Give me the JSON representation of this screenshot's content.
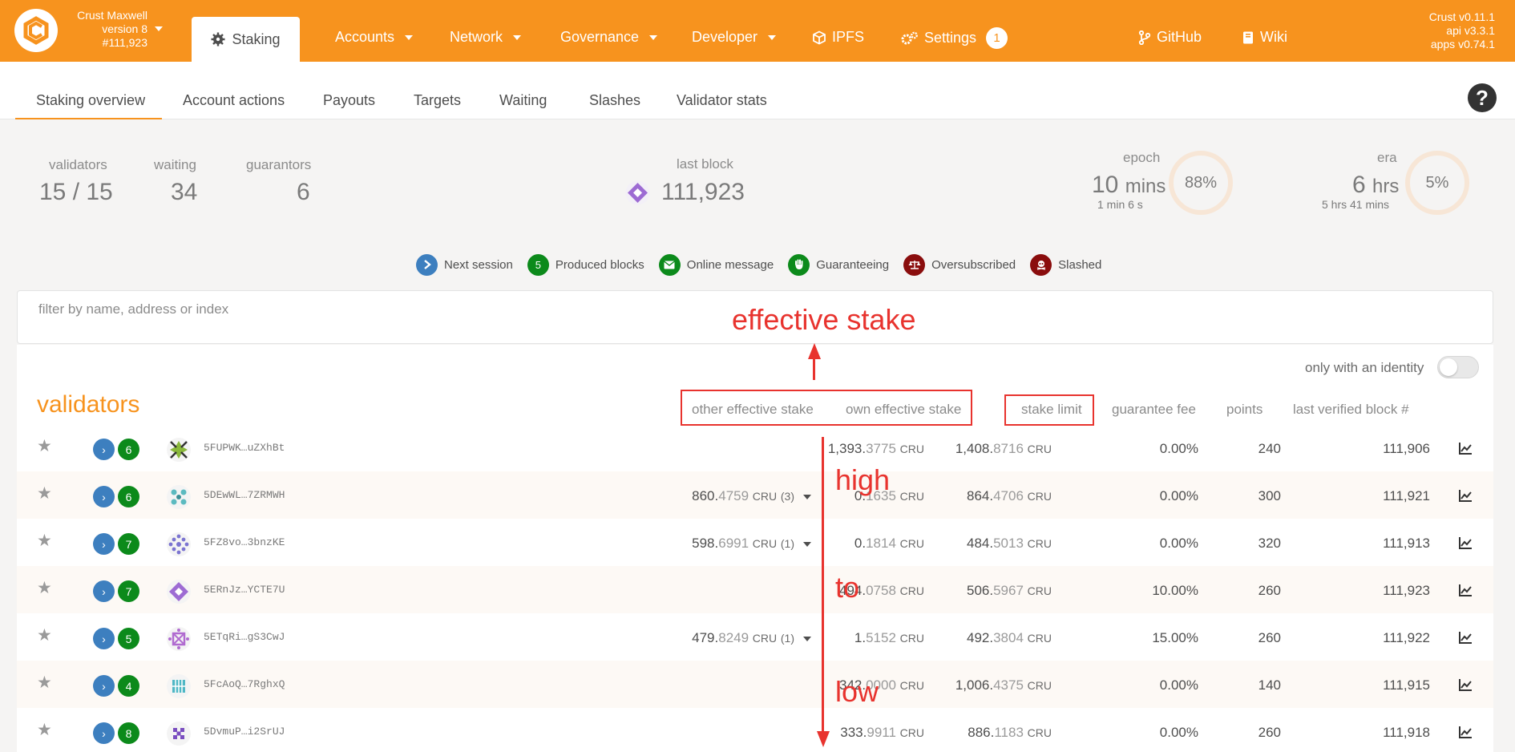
{
  "header": {
    "chain_name": "Crust Maxwell",
    "chain_version": "version 8",
    "chain_block": "#111,923",
    "active_nav": "Staking",
    "nav": [
      {
        "label": "Accounts"
      },
      {
        "label": "Network"
      },
      {
        "label": "Governance"
      },
      {
        "label": "Developer"
      },
      {
        "label": "IPFS"
      },
      {
        "label": "Settings",
        "badge": "1"
      }
    ],
    "links": [
      {
        "label": "GitHub"
      },
      {
        "label": "Wiki"
      }
    ],
    "versions": [
      "Crust v0.11.1",
      "api v3.3.1",
      "apps v0.74.1"
    ],
    "brand_color": "#f7931e"
  },
  "subtabs": [
    "Staking overview",
    "Account actions",
    "Payouts",
    "Targets",
    "Waiting",
    "Slashes",
    "Validator stats"
  ],
  "summary": {
    "validators_label": "validators",
    "validators_value": "15 / 15",
    "waiting_label": "waiting",
    "waiting_value": "34",
    "guarantors_label": "guarantors",
    "guarantors_value": "6",
    "last_block_label": "last block",
    "last_block_value": "111,923",
    "epoch_label": "epoch",
    "epoch_value": "10",
    "epoch_unit": "mins",
    "epoch_sub": "1 min 6 s",
    "epoch_percent": "88%",
    "era_label": "era",
    "era_value": "6",
    "era_unit": "hrs",
    "era_sub": "5 hrs 41 mins",
    "era_percent": "5%"
  },
  "legend": [
    {
      "label": "Next session",
      "color": "#3d7fbf",
      "icon": "chevron-right-icon"
    },
    {
      "label": "Produced blocks",
      "color": "#0c8a1b",
      "text": "5"
    },
    {
      "label": "Online message",
      "color": "#0c8a1b",
      "icon": "envelope-icon"
    },
    {
      "label": "Guaranteeing",
      "color": "#0c8a1b",
      "icon": "hand-icon"
    },
    {
      "label": "Oversubscribed",
      "color": "#8a0d0d",
      "icon": "balance-scale-icon"
    },
    {
      "label": "Slashed",
      "color": "#8a0d0d",
      "icon": "skull-icon"
    }
  ],
  "filter": {
    "placeholder": "filter by name, address or index"
  },
  "toggle_label": "only with an identity",
  "table": {
    "title": "validators",
    "columns": {
      "other_stake": "other effective stake",
      "own_stake": "own effective stake",
      "stake_limit": "stake limit",
      "guarantee_fee": "guarantee fee",
      "points": "points",
      "last_block": "last verified block #"
    },
    "unit": "CRU",
    "rows": [
      {
        "address": "5FUPWK…uZXhBt",
        "blocks": "6",
        "other_int": "",
        "other_dec": "",
        "other_count": "",
        "own_int": "1,393.",
        "own_dec": "3775",
        "limit_int": "1,408.",
        "limit_dec": "8716",
        "fee": "0.00%",
        "points": "240",
        "last": "111,906"
      },
      {
        "address": "5DEwWL…7ZRMWH",
        "blocks": "6",
        "other_int": "860.",
        "other_dec": "4759",
        "other_count": "(3)",
        "own_int": "0.",
        "own_dec": "1635",
        "limit_int": "864.",
        "limit_dec": "4706",
        "fee": "0.00%",
        "points": "300",
        "last": "111,921"
      },
      {
        "address": "5FZ8vo…3bnzKE",
        "blocks": "7",
        "other_int": "598.",
        "other_dec": "6991",
        "other_count": "(1)",
        "own_int": "0.",
        "own_dec": "1814",
        "limit_int": "484.",
        "limit_dec": "5013",
        "fee": "0.00%",
        "points": "320",
        "last": "111,913"
      },
      {
        "address": "5ERnJz…YCTE7U",
        "blocks": "7",
        "other_int": "",
        "other_dec": "",
        "other_count": "",
        "own_int": "494.",
        "own_dec": "0758",
        "limit_int": "506.",
        "limit_dec": "5967",
        "fee": "10.00%",
        "points": "260",
        "last": "111,923"
      },
      {
        "address": "5ETqRi…gS3CwJ",
        "blocks": "5",
        "other_int": "479.",
        "other_dec": "8249",
        "other_count": "(1)",
        "own_int": "1.",
        "own_dec": "5152",
        "limit_int": "492.",
        "limit_dec": "3804",
        "fee": "15.00%",
        "points": "260",
        "last": "111,922"
      },
      {
        "address": "5FcAoQ…7RghxQ",
        "blocks": "4",
        "other_int": "",
        "other_dec": "",
        "other_count": "",
        "own_int": "342.",
        "own_dec": "0000",
        "limit_int": "1,006.",
        "limit_dec": "4375",
        "fee": "0.00%",
        "points": "140",
        "last": "111,915"
      },
      {
        "address": "5DvmuP…i2SrUJ",
        "blocks": "8",
        "other_int": "",
        "other_dec": "",
        "other_count": "",
        "own_int": "333.",
        "own_dec": "9911",
        "limit_int": "886.",
        "limit_dec": "1183",
        "fee": "0.00%",
        "points": "260",
        "last": "111,918"
      }
    ]
  },
  "annotations": {
    "title": "effective stake",
    "high": "high",
    "to": "to",
    "low": "low",
    "color": "#e8332e"
  }
}
